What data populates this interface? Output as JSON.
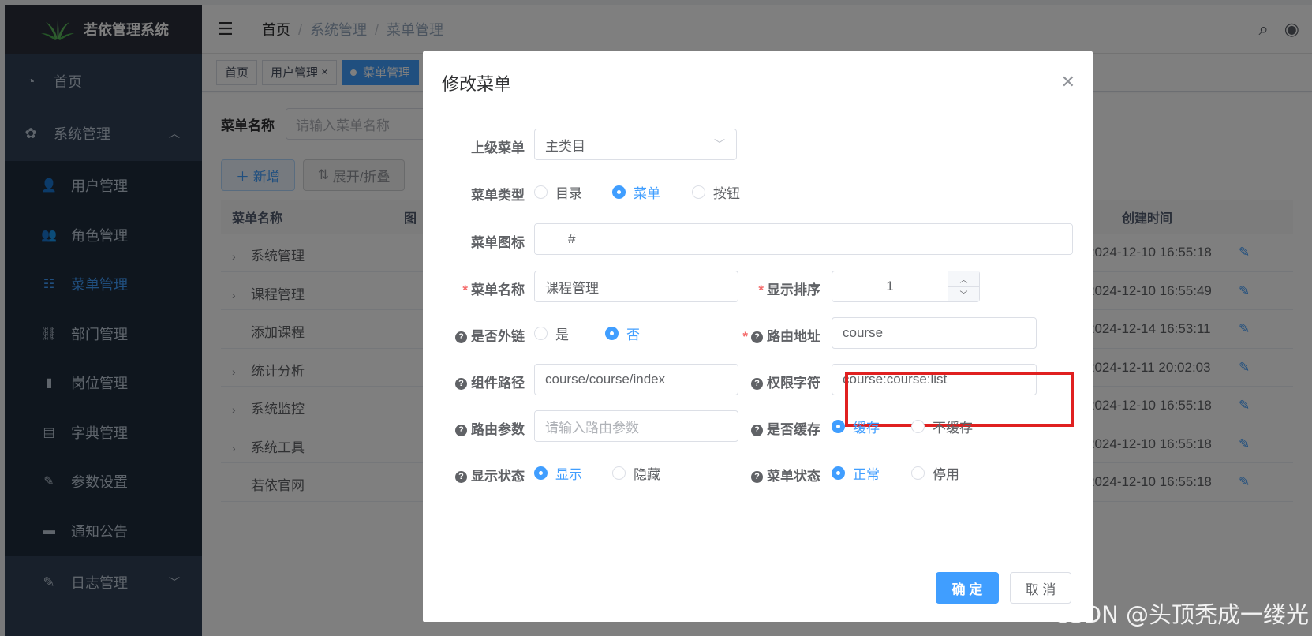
{
  "app": {
    "title": "若依管理系统"
  },
  "sidebar": {
    "home": "首页",
    "system": "系统管理",
    "items": [
      {
        "label": "用户管理",
        "icon": "user-icon"
      },
      {
        "label": "角色管理",
        "icon": "peoples-icon"
      },
      {
        "label": "菜单管理",
        "icon": "tree-table-icon"
      },
      {
        "label": "部门管理",
        "icon": "tree-icon"
      },
      {
        "label": "岗位管理",
        "icon": "post-icon"
      },
      {
        "label": "字典管理",
        "icon": "dict-icon"
      },
      {
        "label": "参数设置",
        "icon": "edit-icon"
      },
      {
        "label": "通知公告",
        "icon": "message-icon"
      }
    ],
    "log": "日志管理",
    "active_color": "#409eff"
  },
  "header": {
    "breadcrumb": [
      "首页",
      "系统管理",
      "菜单管理"
    ]
  },
  "tags": [
    "首页",
    "用户管理",
    "菜单管理"
  ],
  "page": {
    "search_label": "菜单名称",
    "search_placeholder": "请输入菜单名称",
    "add_label": "新增",
    "expand_label": "展开/折叠",
    "columns": [
      "菜单名称",
      "图",
      "创建时间"
    ],
    "rows": [
      {
        "name": "系统管理",
        "expandable": true,
        "time": "2024-12-10 16:55:18"
      },
      {
        "name": "课程管理",
        "expandable": true,
        "time": "2024-12-10 16:55:49"
      },
      {
        "name": "添加课程",
        "expandable": false,
        "time": "2024-12-14 16:53:11"
      },
      {
        "name": "统计分析",
        "expandable": true,
        "time": "2024-12-11 20:02:03"
      },
      {
        "name": "系统监控",
        "expandable": true,
        "time": "2024-12-10 16:55:18"
      },
      {
        "name": "系统工具",
        "expandable": true,
        "time": "2024-12-10 16:55:18"
      },
      {
        "name": "若依官网",
        "expandable": false,
        "time": "2024-12-10 16:55:18"
      }
    ]
  },
  "dialog": {
    "title": "修改菜单",
    "parent_label": "上级菜单",
    "parent_value": "主类目",
    "type_label": "菜单类型",
    "type_options": [
      "目录",
      "菜单",
      "按钮"
    ],
    "type_selected": "菜单",
    "icon_label": "菜单图标",
    "icon_value": "#",
    "name_label": "菜单名称",
    "name_value": "课程管理",
    "order_label": "显示排序",
    "order_value": "1",
    "external_label": "是否外链",
    "external_options": [
      "是",
      "否"
    ],
    "external_selected": "否",
    "route_label": "路由地址",
    "route_value": "course",
    "component_label": "组件路径",
    "component_value": "course/course/index",
    "perms_label": "权限字符",
    "perms_value": "course:course:list",
    "query_label": "路由参数",
    "query_placeholder": "请输入路由参数",
    "cache_label": "是否缓存",
    "cache_options": [
      "缓存",
      "不缓存"
    ],
    "cache_selected": "缓存",
    "visible_label": "显示状态",
    "visible_options": [
      "显示",
      "隐藏"
    ],
    "visible_selected": "显示",
    "status_label": "菜单状态",
    "status_options": [
      "正常",
      "停用"
    ],
    "status_selected": "正常",
    "confirm": "确 定",
    "cancel": "取 消",
    "highlight_color": "#e02020"
  },
  "watermark": "CSDN @头顶秃成一缕光"
}
